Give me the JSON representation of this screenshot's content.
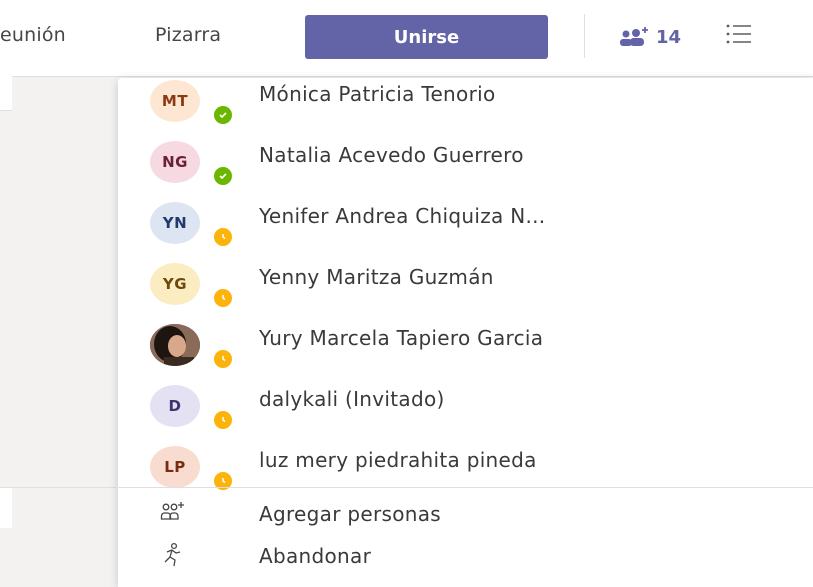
{
  "header": {
    "tabs": [
      {
        "label": "eunión"
      },
      {
        "label": "Pizarra"
      }
    ],
    "join_label": "Unirse",
    "participant_count": "14",
    "colors": {
      "brand": "#6264a7"
    }
  },
  "participants": [
    {
      "initials": "MT",
      "name": "Mónica Patricia Tenorio",
      "status": "available",
      "avatar_bg": "#fde7d3",
      "avatar_fg": "#8a3b12"
    },
    {
      "initials": "NG",
      "name": "Natalia Acevedo Guerrero",
      "status": "available",
      "avatar_bg": "#f7d9e2",
      "avatar_fg": "#6b1f3a"
    },
    {
      "initials": "YN",
      "name": "Yenifer Andrea Chiquiza N...",
      "status": "away",
      "avatar_bg": "#dde5f3",
      "avatar_fg": "#1f3a6b"
    },
    {
      "initials": "YG",
      "name": "Yenny Maritza Guzmán",
      "status": "away",
      "avatar_bg": "#fbecc2",
      "avatar_fg": "#6b4a0a"
    },
    {
      "initials": "",
      "name": "Yury Marcela Tapiero Garcia",
      "status": "away",
      "avatar_bg": "#6b4c3b",
      "avatar_fg": "#ffffff",
      "photo": true
    },
    {
      "initials": "D",
      "name": "dalykali (Invitado)",
      "status": "away",
      "avatar_bg": "#e4e2f2",
      "avatar_fg": "#3a3570"
    },
    {
      "initials": "LP",
      "name": "luz mery piedrahita pineda",
      "status": "away",
      "avatar_bg": "#f8dcd0",
      "avatar_fg": "#7a2c12"
    }
  ],
  "actions": {
    "add_people": "Agregar personas",
    "leave": "Abandonar"
  },
  "status_colors": {
    "available": "#6bb700",
    "away": "#fcb40a"
  }
}
